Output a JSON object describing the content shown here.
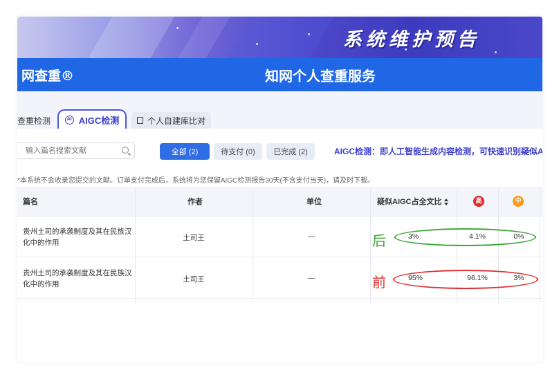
{
  "banner": {
    "text": "系统维护预告"
  },
  "header": {
    "logo": "网查重®",
    "service_title": "知网个人查重服务"
  },
  "tabs": [
    {
      "label": "查重检测"
    },
    {
      "label": "AIGC检测",
      "icon": "ai-icon"
    },
    {
      "label": "个人自建库比对",
      "icon": "database-icon"
    }
  ],
  "search": {
    "placeholder": "输入篇名搜索文献"
  },
  "filters": [
    {
      "label": "全部 (2)"
    },
    {
      "label": "待支付 (0)"
    },
    {
      "label": "已完成 (2)"
    }
  ],
  "promo": "AIGC检测：即人工智能生成内容检测，可快速识别疑似AI",
  "notice": "*本系统不会收录您提交的文献。订单支付完成后，系统将为您保留AIGC检测报告30天(不含支付当天)，请及时下载。",
  "table": {
    "headers": {
      "title": "篇名",
      "author": "作者",
      "unit": "单位",
      "aigc_ratio": "疑似AIGC占全文比",
      "high": "高",
      "mid": "中"
    },
    "rows": [
      {
        "title": "贵州土司的承袭制度及其在民族汉化中的作用",
        "author": "土司王",
        "unit": "—",
        "ratio": "3%",
        "high": "4.1%",
        "mid": "0%",
        "annotation": "后"
      },
      {
        "title": "贵州土司的承袭制度及其在民族汉化中的作用",
        "author": "土司王",
        "unit": "—",
        "ratio": "95%",
        "high": "96.1%",
        "mid": "3%",
        "annotation": "前"
      }
    ]
  },
  "colors": {
    "primary": "#1f67e4",
    "accent": "#3d3fcc",
    "high_badge": "#e02b2b",
    "mid_badge": "#f59a12",
    "annotation_green": "#3aa735",
    "annotation_red": "#e03030"
  }
}
